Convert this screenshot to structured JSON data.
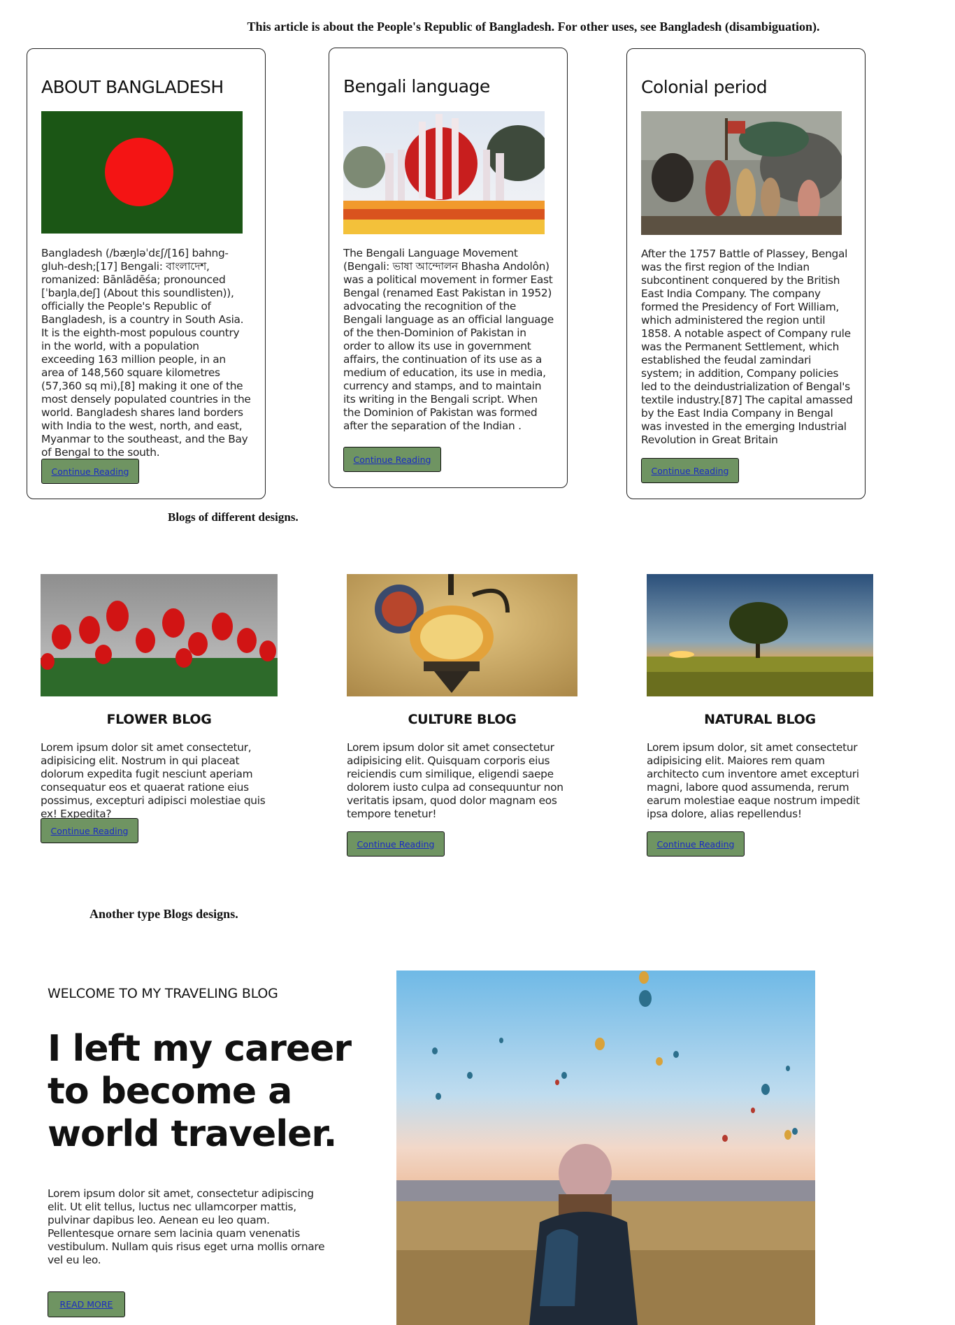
{
  "notice": "This article is about the People's Republic of Bangladesh. For other uses, see Bangladesh (disambiguation).",
  "cards": [
    {
      "title": "ABOUT BANGLADESH",
      "text": "Bangladesh (/bæŋləˈdɛʃ/[16] bahng-gluh-desh;[17] Bengali: বাংলাদেশ, romanized: Bānlādēśa; pronounced [ˈbaŋlaˌdeʃ] (About this soundlisten)), officially the People's Republic of Bangladesh, is a country in South Asia. It is the eighth-most populous country in the world, with a population exceeding 163 million people, in an area of 148,560 square kilometres (57,360 sq mi),[8] making it one of the most densely populated countries in the world. Bangladesh shares land borders with India to the west, north, and east, Myanmar to the southeast, and the Bay of Bengal to the south.",
      "button": "Continue Reading",
      "image": "bangladesh-flag"
    },
    {
      "title": "Bengali language",
      "text": "The Bengali Language Movement (Bengali: ভাষা আন্দোলন Bhasha Andolôn) was a political movement in former East Bengal (renamed East Pakistan in 1952) advocating the recognition of the Bengali language as an official language of the then-Dominion of Pakistan in order to allow its use in government affairs, the continuation of its use as a medium of education, its use in media, currency and stamps, and to maintain its writing in the Bengali script. When the Dominion of Pakistan was formed after the separation of the Indian .",
      "button": "Continue Reading",
      "image": "shaheed-minar-monument"
    },
    {
      "title": "Colonial period",
      "text": "After the 1757 Battle of Plassey, Bengal was the first region of the Indian subcontinent conquered by the British East India Company. The company formed the Presidency of Fort William, which administered the region until 1858. A notable aspect of Company rule was the Permanent Settlement, which established the feudal zamindari system; in addition, Company policies led to the deindustrialization of Bengal's textile industry.[87] The capital amassed by the East India Company in Bengal was invested in the emerging Industrial Revolution in Great Britain",
      "button": "Continue Reading",
      "image": "colonial-painting"
    }
  ],
  "section_heading": "Blogs of different designs.",
  "blogs": [
    {
      "title": "FLOWER BLOG",
      "text": "Lorem ipsum dolor sit amet consectetur, adipisicing elit. Nostrum in qui placeat dolorum expedita fugit nesciunt aperiam consequatur eos et quaerat ratione eius possimus, excepturi adipisci molestiae quis ex! Expedita?",
      "button": "Continue Reading",
      "image": "red-tulips"
    },
    {
      "title": "CULTURE BLOG",
      "text": "Lorem ipsum dolor sit amet consectetur adipisicing elit. Quisquam corporis eius reiciendis cum similique, eligendi saepe dolorem iusto culpa ad consequuntur non veritatis ipsam, quod dolor magnam eos tempore tenetur!",
      "button": "Continue Reading",
      "image": "mosaic-lamp"
    },
    {
      "title": "NATURAL BLOG",
      "text": "Lorem ipsum dolor, sit amet consectetur adipisicing elit. Maiores rem quam architecto cum inventore amet excepturi magni, labore quod assumenda, rerum earum molestiae eaque nostrum impedit ipsa dolore, alias repellendus!",
      "button": "Continue Reading",
      "image": "sunset-tree-field"
    }
  ],
  "another_heading": "Another type Blogs designs.",
  "hero": {
    "kicker": "WELCOME TO MY TRAVELING BLOG",
    "title": "I left my career to become a world traveler.",
    "text": "Lorem ipsum dolor sit amet, consectetur adipiscing elit. Ut elit tellus, luctus nec ullamcorper mattis, pulvinar dapibus leo. Aenean eu leo quam. Pellentesque ornare sem lacinia quam venenatis vestibulum. Nullam quis risus eget urna mollis ornare vel eu leo.",
    "button": "READ MORE",
    "image": "traveler-hot-air-balloons"
  },
  "colors": {
    "button_bg": "#6f9462",
    "link": "#1a2bc4",
    "flag_green": "#1b5615",
    "flag_red": "#f41414"
  }
}
